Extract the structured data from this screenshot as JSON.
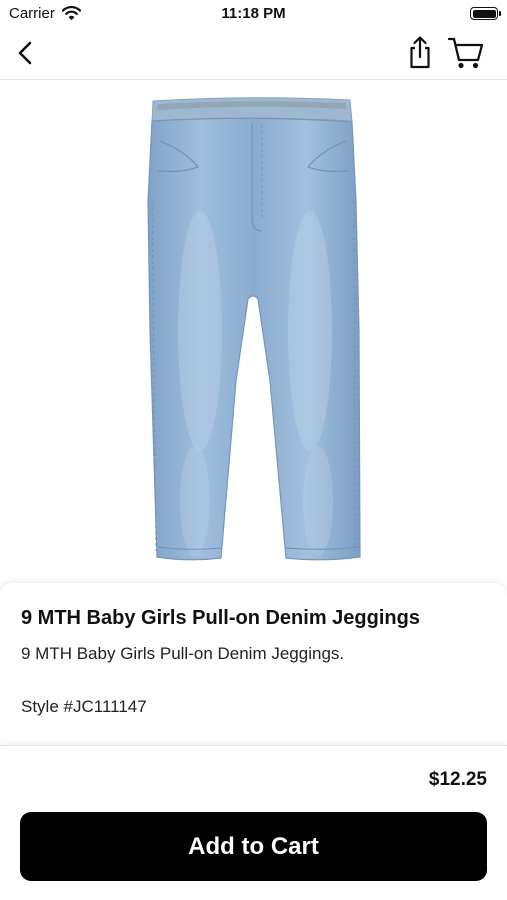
{
  "status_bar": {
    "carrier": "Carrier",
    "time": "11:18 PM",
    "wifi_icon": "wifi-icon",
    "battery_icon": "battery-full-icon"
  },
  "nav": {
    "back_icon": "chevron-left-icon",
    "share_icon": "share-icon",
    "cart_icon": "cart-icon"
  },
  "product": {
    "image": "blue-denim-jeggings",
    "title": "9 MTH Baby Girls Pull-on Denim Jeggings",
    "description": "9 MTH Baby Girls Pull-on Denim Jeggings.",
    "style": "Style #JC111147",
    "price": "$12.25"
  },
  "actions": {
    "add_to_cart_label": "Add to Cart"
  },
  "colors": {
    "button_bg": "#000000",
    "button_text": "#ffffff",
    "denim": "#8fb1d2"
  }
}
